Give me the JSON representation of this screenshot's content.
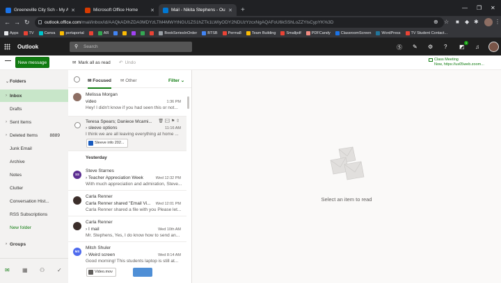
{
  "browser": {
    "tabs": [
      {
        "title": "Greeneville City Sch - My Apps",
        "color": "#1a73e8",
        "active": false
      },
      {
        "title": "Microsoft Office Home",
        "color": "#d83b01",
        "active": false
      },
      {
        "title": "Mail - Nikita Stephens - Outlook",
        "color": "#0078d4",
        "active": true
      }
    ],
    "url_host": "outlook.office.com",
    "url_path": "/mail/inbox/id/AAQkADIhZDA0MDYzLTM4MWYtNGU1ZS1hZTk1LWIyODY2NDUzYzcxNgAQAFoU6kSShLoZZYlsCypYK%3D",
    "bookmarks": [
      {
        "label": "Apps",
        "color": "#e8eaed"
      },
      {
        "label": "TV",
        "color": "#ea4335"
      },
      {
        "label": "Canva",
        "color": "#00c4cc"
      },
      {
        "label": "portaportal",
        "color": "#fbbc04"
      },
      {
        "label": "",
        "color": "#ea4335"
      },
      {
        "label": "AR",
        "color": "#34a853"
      },
      {
        "label": "",
        "color": "#4285f4"
      },
      {
        "label": "",
        "color": "#fbbc04"
      },
      {
        "label": "",
        "color": "#a142f4"
      },
      {
        "label": "",
        "color": "#34a853"
      },
      {
        "label": "",
        "color": "#ea4335"
      },
      {
        "label": "BookSeriesInOrder",
        "color": "#9aa0a6"
      },
      {
        "label": "BTSB",
        "color": "#4285f4"
      },
      {
        "label": "Perma8",
        "color": "#ea4335"
      },
      {
        "label": "Team Building",
        "color": "#fbbc04"
      },
      {
        "label": "Smallpdf",
        "color": "#ea4335"
      },
      {
        "label": "PDFCandy",
        "color": "#f28b82"
      },
      {
        "label": "ClassroomScreen",
        "color": "#1a73e8"
      },
      {
        "label": "WordPress",
        "color": "#21759b"
      },
      {
        "label": "TV Student Contact...",
        "color": "#ea4335"
      }
    ]
  },
  "outlook": {
    "brand": "Outlook",
    "search_placeholder": "Search",
    "badge_count": "1",
    "new_mail": "New message",
    "mark_all_read": "Mark all as read",
    "undo": "Undo",
    "class_meeting": {
      "line1": "Class Meeting",
      "line2": "Now, https://us05web.zoom..."
    }
  },
  "nav": {
    "folders_label": "Folders",
    "items": [
      {
        "label": "Inbox",
        "chev": "›",
        "count": "",
        "selected": true
      },
      {
        "label": "Drafts",
        "chev": "",
        "count": ""
      },
      {
        "label": "Sent Items",
        "chev": "›",
        "count": ""
      },
      {
        "label": "Deleted Items",
        "chev": "›",
        "count": "8889"
      },
      {
        "label": "Junk Email",
        "chev": "",
        "count": ""
      },
      {
        "label": "Archive",
        "chev": "",
        "count": ""
      },
      {
        "label": "Notes",
        "chev": "",
        "count": ""
      },
      {
        "label": "Clutter",
        "chev": "",
        "count": ""
      },
      {
        "label": "Conversation Hist...",
        "chev": "",
        "count": ""
      },
      {
        "label": "RSS Subscriptions",
        "chev": "",
        "count": ""
      }
    ],
    "new_folder": "New folder",
    "groups_label": "Groups"
  },
  "list": {
    "focused": "Focused",
    "other": "Other",
    "filter": "Filter",
    "yesterday": "Yesterday",
    "messages": [
      {
        "from": "Melissa Morgan",
        "subject": "video",
        "preview": "Hey! I didn't know if you had seen this or not...",
        "time": "1:36 PM",
        "avatar": "",
        "avatar_color": "#8d6e63"
      },
      {
        "from": "Teresa Spears; Daniece Mcami...",
        "subject": "sleeve options",
        "preview": "I think we are all leaving everything at home ...",
        "time": "11:16 AM",
        "attachment": "Sleeve info 202...",
        "avatar": "",
        "avatar_color": "#ffffff"
      },
      {
        "from": "Steve Starnes",
        "subject": "Teacher Appreciation Week",
        "preview": "With much appreciation and admiration, Steve...",
        "time": "Wed 12:32 PM",
        "avatar": "SS",
        "avatar_color": "#5c2e91"
      },
      {
        "from": "Carla Renner",
        "subject": "Carla Renner shared \"Email Vi...",
        "preview": "Carla Renner shared a file with you Please let...",
        "time": "Wed 12:01 PM",
        "avatar": "",
        "avatar_color": "#3b2e2a"
      },
      {
        "from": "Carla Renner",
        "subject": "I mail",
        "preview": "Mr. Stephens, Yes, I do know how to send an...",
        "time": "Wed 10th AM",
        "avatar": "",
        "avatar_color": "#3b2e2a"
      },
      {
        "from": "Mitch Shuler",
        "subject": "Weird screen",
        "preview": "Good morning! This students laptop is still at...",
        "time": "Wed 8:14 AM",
        "attachment": "Video.mov",
        "avatar": "MS",
        "avatar_color": "#4f6bed"
      }
    ]
  },
  "reader": {
    "empty_text": "Select an item to read"
  }
}
